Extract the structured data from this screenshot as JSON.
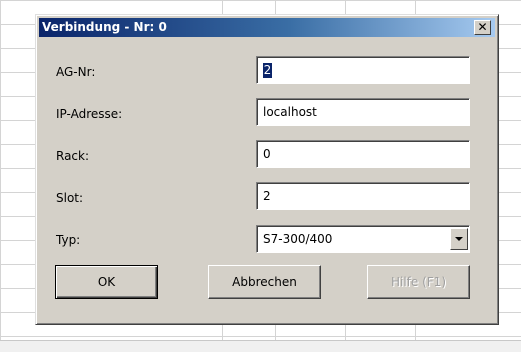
{
  "dialog": {
    "title": "Verbindung - Nr: 0",
    "close_glyph": "✕"
  },
  "fields": {
    "ag_nr": {
      "label": "AG-Nr:",
      "value": "2"
    },
    "ip_adresse": {
      "label": "IP-Adresse:",
      "value": "localhost"
    },
    "rack": {
      "label": "Rack:",
      "value": "0"
    },
    "slot": {
      "label": "Slot:",
      "value": "2"
    },
    "typ": {
      "label": "Typ:",
      "value": "S7-300/400"
    }
  },
  "buttons": {
    "ok": "OK",
    "cancel": "Abbrechen",
    "help": "Hilfe (F1)"
  },
  "colors": {
    "title_bar_start": "#0a246a",
    "title_bar_end": "#a6caf0",
    "dialog_face": "#d4d0c8",
    "selection": "#0a246a"
  }
}
